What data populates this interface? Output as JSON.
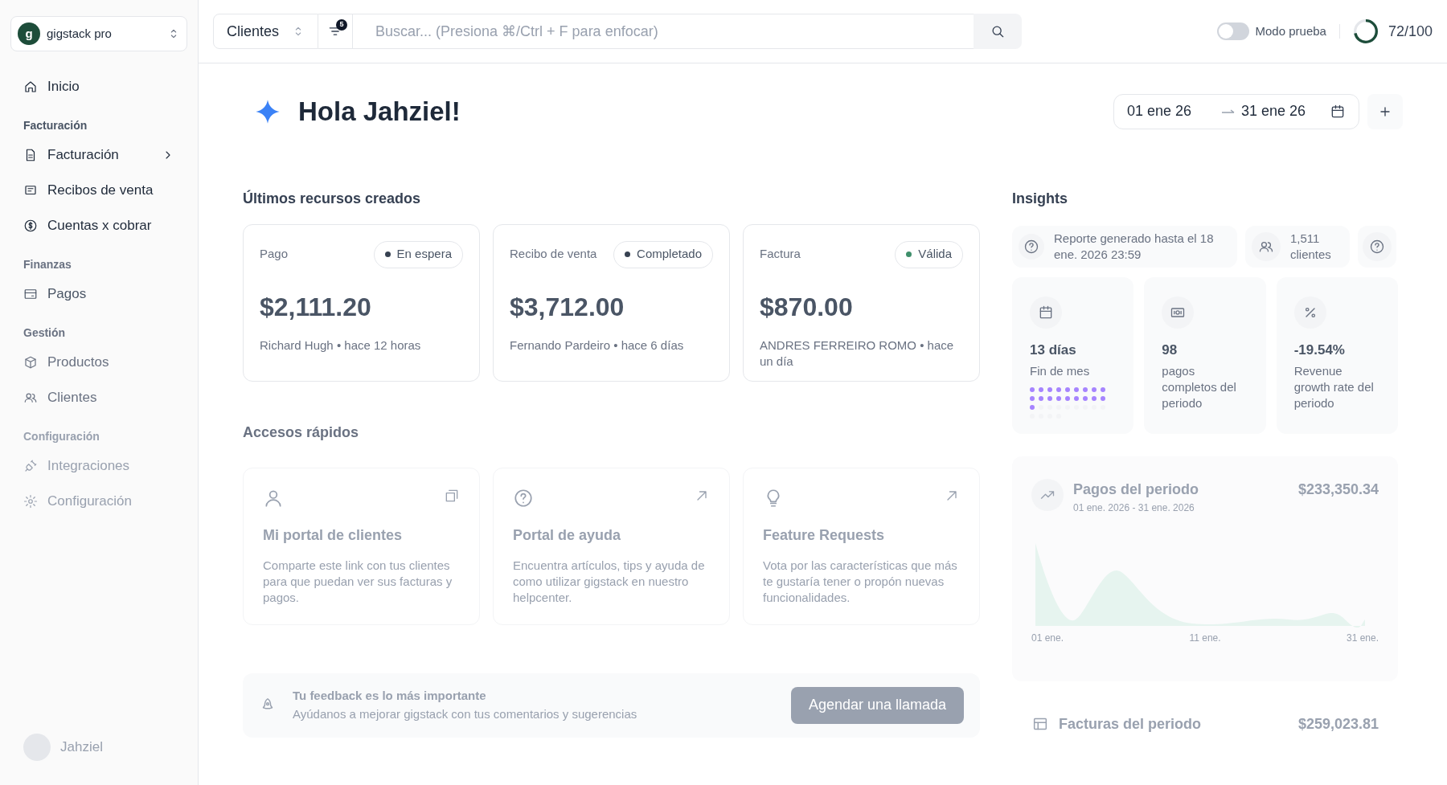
{
  "workspace": {
    "initial": "g",
    "name": "gigstack pro"
  },
  "search": {
    "scope": "Clientes",
    "filter_count": "5",
    "placeholder": "Buscar... (Presiona ⌘/Ctrl + F para enfocar)"
  },
  "test_mode": {
    "label": "Modo prueba",
    "on": false
  },
  "usage": {
    "text": "72/100",
    "level": 0.72
  },
  "sidebar": {
    "top": [
      {
        "label": "Inicio"
      }
    ],
    "sections": [
      {
        "heading": "Facturación",
        "items": [
          {
            "label": "Facturación",
            "submenu": true
          },
          {
            "label": "Recibos de venta",
            "submenu": false
          },
          {
            "label": "Cuentas x cobrar",
            "submenu": false
          }
        ]
      },
      {
        "heading": "Finanzas",
        "items": [
          {
            "label": "Pagos",
            "submenu": false
          }
        ]
      },
      {
        "heading": "Gestión",
        "items": [
          {
            "label": "Productos",
            "submenu": false
          },
          {
            "label": "Clientes",
            "submenu": false
          }
        ]
      },
      {
        "heading": "Configuración",
        "items": [
          {
            "label": "Integraciones",
            "submenu": false
          },
          {
            "label": "Configuración",
            "submenu": false
          }
        ]
      }
    ],
    "user": {
      "name": "Jahziel"
    }
  },
  "greeting": "Hola Jahziel!",
  "date_range": {
    "start": "01 ene 26",
    "end": "31 ene 26"
  },
  "recent": {
    "title": "Últimos recursos creados",
    "cards": [
      {
        "type": "Pago",
        "status": "En espera",
        "color": "#374151",
        "amount": "$2,111.20",
        "meta": "Richard Hugh • hace 12 horas"
      },
      {
        "type": "Recibo de venta",
        "status": "Completado",
        "color": "#374151",
        "amount": "$3,712.00",
        "meta": "Fernando Pardeiro • hace 6 días"
      },
      {
        "type": "Factura",
        "status": "Válida",
        "color": "#3f8f6b",
        "amount": "$870.00",
        "meta": "ANDRES FERREIRO ROMO • hace un día"
      }
    ]
  },
  "quick": {
    "title": "Accesos rápidos",
    "cards": [
      {
        "title": "Mi portal de clientes",
        "text": "Comparte este link con tus clientes para que puedan ver sus facturas y pagos."
      },
      {
        "title": "Portal de ayuda",
        "text": "Encuentra artículos, tips y ayuda de como utilizar gigstack en nuestro helpcenter."
      },
      {
        "title": "Feature Requests",
        "text": "Vota por las características que más te gustaría tener o propón nuevas funcionalidades."
      }
    ]
  },
  "feedback": {
    "title": "Tu feedback es lo más importante",
    "text": "Ayúdanos a mejorar gigstack con tus comentarios y sugerencias",
    "button": "Agendar una llamada"
  },
  "insights": {
    "title": "Insights",
    "report": "Reporte generado hasta el 18 ene. 2026 23:59",
    "clients": "1,511 clientes",
    "stats": [
      {
        "value": "13 días",
        "label": "Fin de mes",
        "level": 0.613
      },
      {
        "value": "98",
        "label": "pagos completos del periodo"
      },
      {
        "value": "-19.54%",
        "label": "Revenue growth rate del periodo"
      }
    ],
    "payments": {
      "title": "Pagos del periodo",
      "range": "01 ene. 2026 - 31 ene. 2026",
      "total": "$233,350.34",
      "axis": [
        "01 ene.",
        "11 ene.",
        "31 ene."
      ]
    },
    "invoices": {
      "title": "Facturas del periodo",
      "total": "$259,023.81"
    }
  }
}
